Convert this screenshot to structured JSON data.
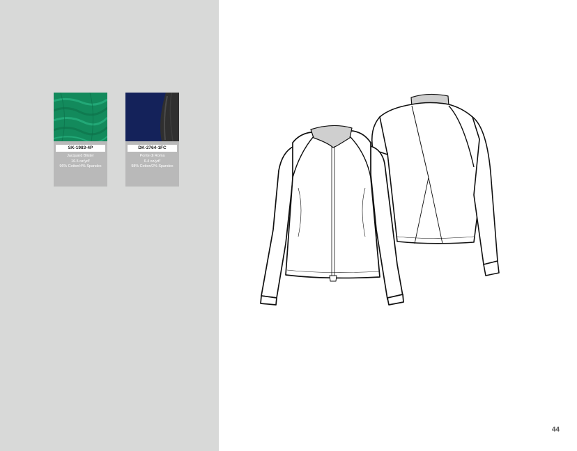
{
  "swatches": [
    {
      "code": "SK-1983-4P",
      "name": "Jacquard Blister",
      "weight": "16.5 oz/yd²",
      "content": "96% Cotton/4% Spandex",
      "colors": [
        "#138a5c",
        "#1fa575"
      ]
    },
    {
      "code": "DK-2764-1FC",
      "name": "Ponte di Roma",
      "weight": "6.4 oz/yd²",
      "content": "98% Cotton/2% Spandex",
      "colors": [
        "#14225a",
        "#2d2d2d"
      ]
    }
  ],
  "page_number": "44"
}
